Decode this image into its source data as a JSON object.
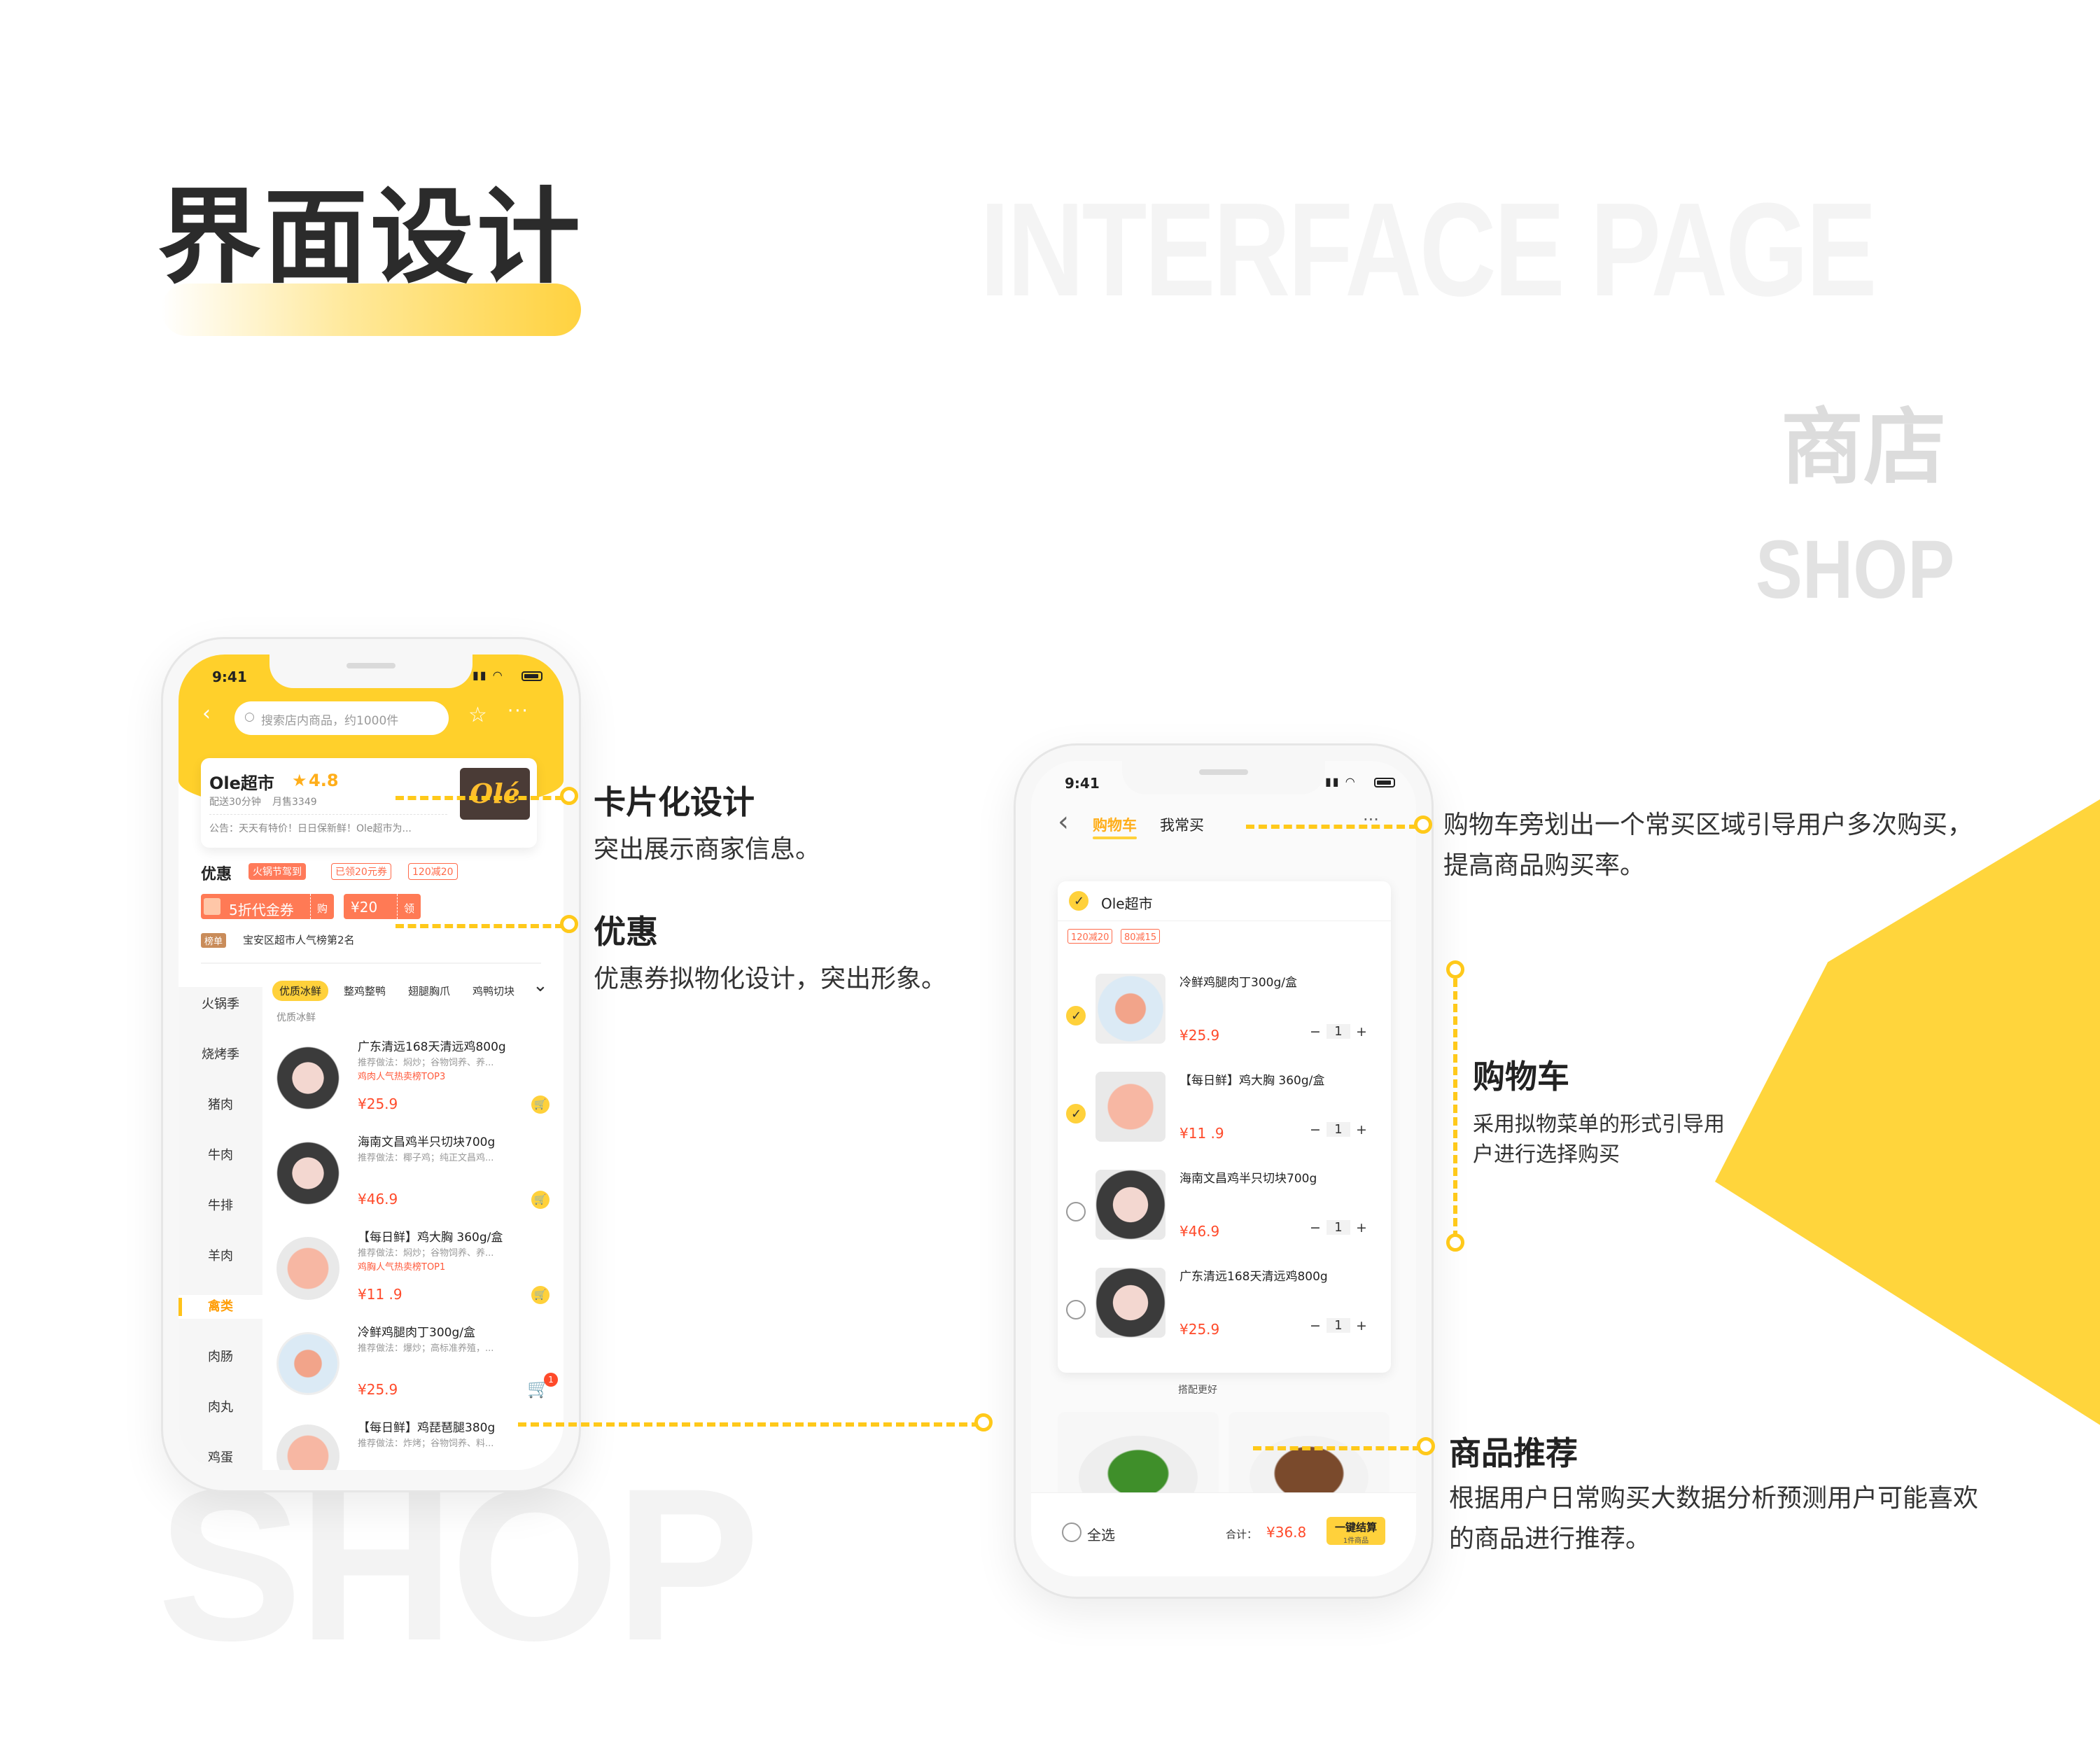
{
  "page": {
    "title": "界面设计",
    "bg_heading": "INTERFACE PAGE",
    "section_cn": "商店",
    "section_en": "SHOP",
    "bg_word": "SHOP"
  },
  "colors": {
    "accent": "#ffd13b",
    "price": "#ff4a2a",
    "brand_dark": "#4a3b36"
  },
  "phone1": {
    "status_time": "9:41",
    "search_placeholder": "搜索店内商品，约1000件",
    "shop": {
      "name": "Ole超市",
      "rating": "4.8",
      "delivery": "配送30分钟",
      "monthly_sales": "月售3349",
      "notice": "公告：天天有特价！日日保新鲜！Ole超市为...",
      "logo_text": "Olé"
    },
    "promo": {
      "label": "优惠",
      "tags": [
        "火锅节驾到",
        "已领20元券",
        "120减20"
      ],
      "coupon1_text": "5折代金券",
      "coupon1_action": "购",
      "coupon2_text": "¥20",
      "coupon2_action": "领",
      "rank_tag": "榜单",
      "rank_text": "宝安区超市人气榜第2名"
    },
    "sidebar": [
      "火锅季",
      "烧烤季",
      "猪肉",
      "牛肉",
      "牛排",
      "羊肉",
      "禽类",
      "肉肠",
      "肉丸",
      "鸡蛋"
    ],
    "chips": [
      "优质冰鲜",
      "整鸡整鸭",
      "翅腿胸爪",
      "鸡鸭切块"
    ],
    "sub_label": "优质冰鲜",
    "products": [
      {
        "name": "广东清远168天清远鸡800g",
        "sub": "推荐做法：焖炒；谷物饲养、养...",
        "hot": "鸡肉人气热卖榜TOP3",
        "price": "¥25.9"
      },
      {
        "name": "海南文昌鸡半只切块700g",
        "sub": "推荐做法：椰子鸡；纯正文昌鸡...",
        "hot": "",
        "price": "¥46.9"
      },
      {
        "name": "【每日鲜】鸡大胸 360g/盒",
        "sub": "推荐做法：焖炒；谷物饲养、养...",
        "hot": "鸡胸人气热卖榜TOP1",
        "price": "¥11 .9"
      },
      {
        "name": "冷鲜鸡腿肉丁300g/盒",
        "sub": "推荐做法：爆炒；高标准养殖，...",
        "hot": "",
        "price": "¥25.9"
      },
      {
        "name": "【每日鲜】鸡琵琶腿380g",
        "sub": "推荐做法：炸烤；谷物饲养、料...",
        "hot": "",
        "price": ""
      }
    ],
    "cart_badge": "1"
  },
  "phone2": {
    "status_time": "9:41",
    "tabs": [
      "购物车",
      "我常买"
    ],
    "store_name": "Ole超市",
    "tags": [
      "120减20",
      "80减15"
    ],
    "items": [
      {
        "name": "冷鲜鸡腿肉丁300g/盒",
        "price": "¥25.9",
        "qty": "1",
        "checked": true
      },
      {
        "name": "【每日鲜】鸡大胸 360g/盒",
        "price": "¥11 .9",
        "qty": "1",
        "checked": true
      },
      {
        "name": "海南文昌鸡半只切块700g",
        "price": "¥46.9",
        "qty": "1",
        "checked": false
      },
      {
        "name": "广东清远168天清远鸡800g",
        "price": "¥25.9",
        "qty": "1",
        "checked": false
      }
    ],
    "divider": "搭配更好",
    "select_all": "全选",
    "total_label": "合计：",
    "total": "¥36.8",
    "checkout": "一键结算",
    "checkout_sub": "1件商品"
  },
  "annotations": {
    "card_title": "卡片化设计",
    "card_desc": "突出展示商家信息。",
    "promo_title": "优惠",
    "promo_desc": "优惠券拟物化设计，突出形象。",
    "frequent_desc1": "购物车旁划出一个常买区域引导用户多次购买，",
    "frequent_desc2": "提高商品购买率。",
    "cart_title": "购物车",
    "cart_desc1": "采用拟物菜单的形式引导用",
    "cart_desc2": "户进行选择购买",
    "rec_title": "商品推荐",
    "rec_desc1": "根据用户日常购买大数据分析预测用户可能喜欢",
    "rec_desc2": "的商品进行推荐。"
  }
}
